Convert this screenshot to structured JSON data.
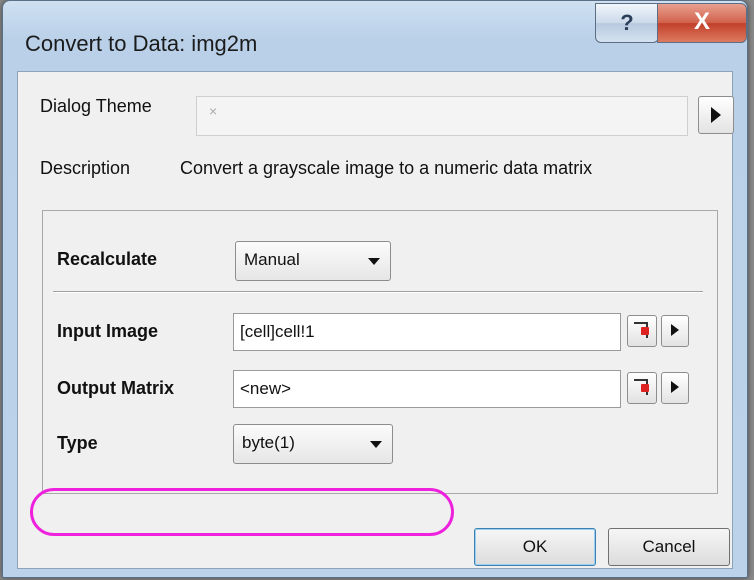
{
  "window": {
    "title": "Convert to Data: img2m",
    "help_label": "?",
    "close_label": "X"
  },
  "header": {
    "dialog_theme_label": "Dialog Theme",
    "dialog_theme_value": "×",
    "description_label": "Description",
    "description_text": "Convert a grayscale image to a numeric data matrix"
  },
  "params": {
    "recalculate_label": "Recalculate",
    "recalculate_value": "Manual",
    "input_image_label": "Input Image",
    "input_image_value": "[cell]cell!1",
    "output_matrix_label": "Output Matrix",
    "output_matrix_value": "<new>",
    "type_label": "Type",
    "type_value": "byte(1)"
  },
  "buttons": {
    "ok": "OK",
    "cancel": "Cancel"
  },
  "colors": {
    "highlight": "#ee22dd"
  }
}
